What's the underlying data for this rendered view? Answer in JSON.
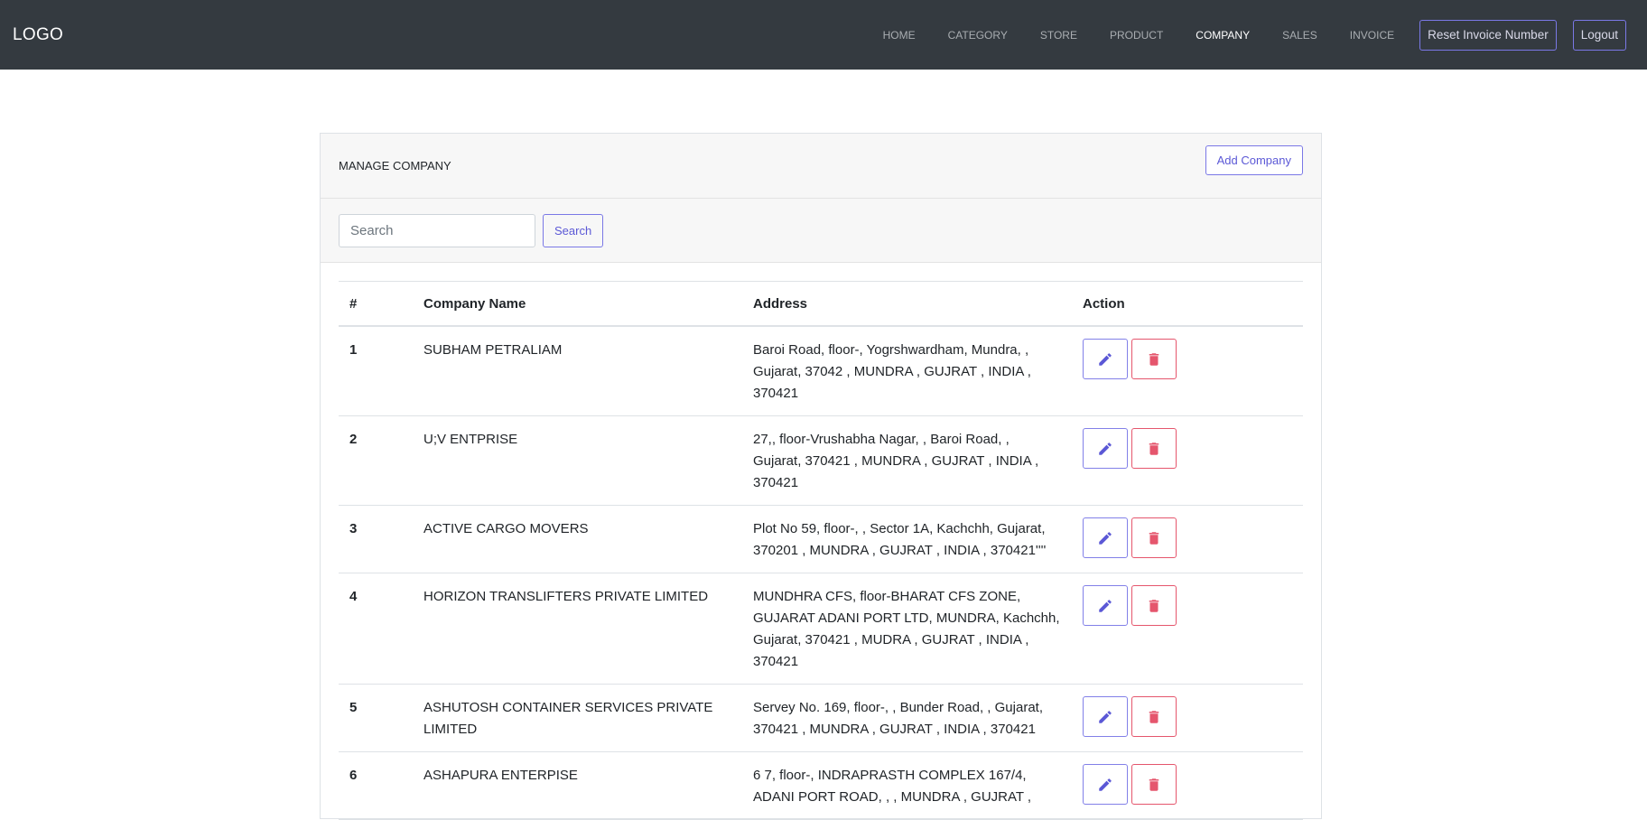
{
  "navbar": {
    "logo": "LOGO",
    "links": [
      {
        "label": "HOME",
        "active": false
      },
      {
        "label": "CATEGORY",
        "active": false
      },
      {
        "label": "STORE",
        "active": false
      },
      {
        "label": "PRODUCT",
        "active": false
      },
      {
        "label": "COMPANY",
        "active": true
      },
      {
        "label": "SALES",
        "active": false
      },
      {
        "label": "INVOICE",
        "active": false
      }
    ],
    "reset_label": "Reset Invoice Number",
    "logout_label": "Logout"
  },
  "card": {
    "title": "MANAGE COMPANY",
    "add_label": "Add Company"
  },
  "search": {
    "placeholder": "Search",
    "value": "",
    "button_label": "Search"
  },
  "table": {
    "headers": [
      "#",
      "Company Name",
      "Address",
      "Action"
    ],
    "rows": [
      {
        "num": "1",
        "name": "SUBHAM PETRALIAM",
        "address": "Baroi Road, floor-, Yogrshwardham, Mundra, , Gujarat, 37042 , MUNDRA , GUJRAT , INDIA , 370421"
      },
      {
        "num": "2",
        "name": "U;V ENTPRISE",
        "address": "27,, floor-Vrushabha Nagar, , Baroi Road, , Gujarat, 370421 , MUNDRA , GUJRAT , INDIA , 370421"
      },
      {
        "num": "3",
        "name": "ACTIVE CARGO MOVERS",
        "address": "Plot No 59, floor-, , Sector 1A, Kachchh, Gujarat, 370201 , MUNDRA , GUJRAT , INDIA , 370421''''"
      },
      {
        "num": "4",
        "name": "HORIZON TRANSLIFTERS PRIVATE LIMITED",
        "address": "MUNDHRA CFS, floor-BHARAT CFS ZONE, GUJARAT ADANI PORT LTD, MUNDRA, Kachchh, Gujarat, 370421 , MUDRA , GUJRAT , INDIA , 370421"
      },
      {
        "num": "5",
        "name": "ASHUTOSH CONTAINER SERVICES PRIVATE LIMITED",
        "address": "Servey No. 169, floor-, , Bunder Road, , Gujarat, 370421 , MUNDRA , GUJRAT , INDIA , 370421"
      },
      {
        "num": "6",
        "name": "ASHAPURA ENTERPISE",
        "address": "6 7, floor-, INDRAPRASTH COMPLEX 167/4, ADANI PORT ROAD, , , MUNDRA , GUJRAT ,"
      }
    ]
  },
  "colors": {
    "navbar_bg": "#343a40",
    "accent": "#5b58d6",
    "danger": "#e5566d"
  },
  "icons": {
    "edit": "pencil-icon",
    "delete": "trash-icon"
  }
}
